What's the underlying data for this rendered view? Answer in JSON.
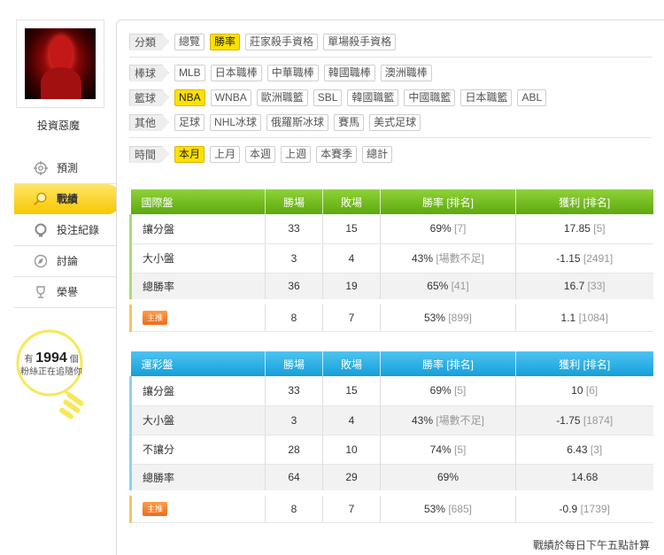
{
  "user": {
    "name": "投資惡魔"
  },
  "nav": {
    "items": [
      {
        "label": "預測",
        "icon": "target-icon"
      },
      {
        "label": "戰績",
        "icon": "magnifier-icon"
      },
      {
        "label": "投注紀錄",
        "icon": "lightbulb-icon"
      },
      {
        "label": "討論",
        "icon": "compass-icon"
      },
      {
        "label": "榮譽",
        "icon": "trophy-icon"
      }
    ]
  },
  "fans": {
    "prefix": "有",
    "count": "1994",
    "unit": "個",
    "caption": "粉絲正在追隨你"
  },
  "filters": {
    "category": {
      "label": "分類",
      "options": [
        "總覽",
        "勝率",
        "莊家殺手資格",
        "單場殺手資格"
      ],
      "selected": "勝率"
    },
    "baseball": {
      "label": "棒球",
      "options": [
        "MLB",
        "日本職棒",
        "中華職棒",
        "韓國職棒",
        "澳洲職棒"
      ]
    },
    "basketball": {
      "label": "籃球",
      "options": [
        "NBA",
        "WNBA",
        "歐洲職籃",
        "SBL",
        "韓國職籃",
        "中國職籃",
        "日本職籃",
        "ABL"
      ],
      "selected": "NBA"
    },
    "other": {
      "label": "其他",
      "options": [
        "足球",
        "NHL冰球",
        "俄羅斯冰球",
        "賽馬",
        "美式足球"
      ]
    },
    "time": {
      "label": "時間",
      "options": [
        "本月",
        "上月",
        "本週",
        "上週",
        "本賽季",
        "總計"
      ],
      "selected": "本月"
    }
  },
  "tables": {
    "international": {
      "title": "國際盤",
      "columns": [
        "勝場",
        "敗場",
        "勝率 [排名]",
        "獲利 [排名]"
      ],
      "rows": [
        {
          "name": "讓分盤",
          "win": "33",
          "loss": "15",
          "rate": "69%",
          "rate_rank": "[7]",
          "profit": "17.85",
          "profit_rank": "[5]"
        },
        {
          "name": "大小盤",
          "win": "3",
          "loss": "4",
          "rate": "43%",
          "rate_rank": "[場數不足]",
          "profit": "-1.15",
          "profit_rank": "[2491]"
        },
        {
          "name": "總勝率",
          "win": "36",
          "loss": "19",
          "rate": "65%",
          "rate_rank": "[41]",
          "profit": "16.7",
          "profit_rank": "[33]"
        }
      ],
      "guest": {
        "badge": "主推",
        "win": "8",
        "loss": "7",
        "rate": "53%",
        "rate_rank": "[899]",
        "profit": "1.1",
        "profit_rank": "[1084]"
      }
    },
    "lottery": {
      "title": "運彩盤",
      "columns": [
        "勝場",
        "敗場",
        "勝率 [排名]",
        "獲利 [排名]"
      ],
      "rows": [
        {
          "name": "讓分盤",
          "win": "33",
          "loss": "15",
          "rate": "69%",
          "rate_rank": "[5]",
          "profit": "10",
          "profit_rank": "[6]"
        },
        {
          "name": "大小盤",
          "win": "3",
          "loss": "4",
          "rate": "43%",
          "rate_rank": "[場數不足]",
          "profit": "-1.75",
          "profit_rank": "[1874]"
        },
        {
          "name": "不讓分",
          "win": "28",
          "loss": "10",
          "rate": "74%",
          "rate_rank": "[5]",
          "profit": "6.43",
          "profit_rank": "[3]"
        },
        {
          "name": "總勝率",
          "win": "64",
          "loss": "29",
          "rate": "69%",
          "rate_rank": "",
          "profit": "14.68",
          "profit_rank": ""
        }
      ],
      "guest": {
        "badge": "主推",
        "win": "8",
        "loss": "7",
        "rate": "53%",
        "rate_rank": "[685]",
        "profit": "-0.9",
        "profit_rank": "[1739]"
      }
    }
  },
  "footnote": "戰績於每日下午五點計算",
  "colors": {
    "accent_yellow": "#ffe100",
    "table_green": "#6cb61a",
    "table_blue": "#1fa7e0",
    "badge_orange": "#f47a24"
  }
}
